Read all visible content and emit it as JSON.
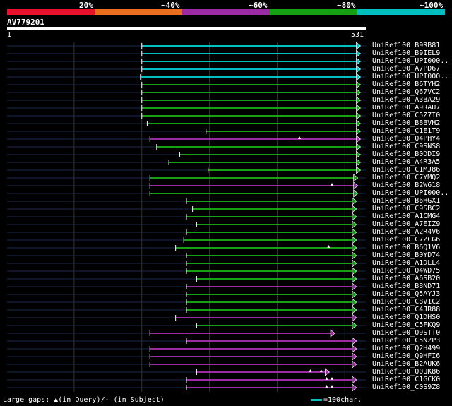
{
  "color_scale": {
    "labels": [
      "20%",
      "~40%",
      "~60%",
      "~80%",
      "~100%"
    ],
    "colors": [
      "#e8102d",
      "#e86f1c",
      "#9b2ba3",
      "#16a016",
      "#00bfc0"
    ]
  },
  "query": {
    "name": "AV779201",
    "start": "1",
    "end": "531",
    "length": 531
  },
  "colors": {
    "background": "#000000",
    "grid": "#333333",
    "track": "#1b2a4d",
    "text": "#ffffff"
  },
  "hits": [
    {
      "name": "UniRef100_B9RB81",
      "start": 200,
      "end": 519,
      "color": "#00bfc0",
      "arrow": "end",
      "gaps": []
    },
    {
      "name": "UniRef100_B9IEL9",
      "start": 200,
      "end": 519,
      "color": "#00bfc0",
      "arrow": "end",
      "gaps": []
    },
    {
      "name": "UniRef100_UPI000..",
      "start": 200,
      "end": 519,
      "color": "#00bfc0",
      "arrow": "end",
      "gaps": []
    },
    {
      "name": "UniRef100_A7PD67",
      "start": 200,
      "end": 519,
      "color": "#00bfc0",
      "arrow": "end",
      "gaps": []
    },
    {
      "name": "UniRef100_UPI000..",
      "start": 198,
      "end": 519,
      "color": "#00bfc0",
      "arrow": "end",
      "gaps": []
    },
    {
      "name": "UniRef100_B6TYH2",
      "start": 200,
      "end": 519,
      "color": "#16a016",
      "arrow": "end",
      "gaps": []
    },
    {
      "name": "UniRef100_Q67VC2",
      "start": 200,
      "end": 519,
      "color": "#16a016",
      "arrow": "end",
      "gaps": []
    },
    {
      "name": "UniRef100_A3BA29",
      "start": 200,
      "end": 519,
      "color": "#16a016",
      "arrow": "end",
      "gaps": []
    },
    {
      "name": "UniRef100_A9RAU7",
      "start": 200,
      "end": 519,
      "color": "#16a016",
      "arrow": "end",
      "gaps": []
    },
    {
      "name": "UniRef100_C5Z7I0",
      "start": 200,
      "end": 519,
      "color": "#16a016",
      "arrow": "end",
      "gaps": []
    },
    {
      "name": "UniRef100_B8BVH2",
      "start": 208,
      "end": 519,
      "color": "#16a016",
      "arrow": "end",
      "gaps": []
    },
    {
      "name": "UniRef100_C1E1T9",
      "start": 295,
      "end": 519,
      "color": "#16a016",
      "arrow": "end",
      "gaps": []
    },
    {
      "name": "UniRef100_Q4PHY4",
      "start": 212,
      "end": 519,
      "color": "#9b2ba3",
      "arrow": "end",
      "gaps": [
        433
      ]
    },
    {
      "name": "UniRef100_C9SNS8",
      "start": 222,
      "end": 519,
      "color": "#16a016",
      "arrow": "end",
      "gaps": []
    },
    {
      "name": "UniRef100_B0DDI9",
      "start": 256,
      "end": 519,
      "color": "#16a016",
      "arrow": "end",
      "gaps": []
    },
    {
      "name": "UniRef100_A4R3A5",
      "start": 240,
      "end": 519,
      "color": "#16a016",
      "arrow": "end",
      "gaps": []
    },
    {
      "name": "UniRef100_C1MJ86",
      "start": 298,
      "end": 519,
      "color": "#16a016",
      "arrow": "end",
      "gaps": []
    },
    {
      "name": "UniRef100_C7YMQ2",
      "start": 212,
      "end": 515,
      "color": "#16a016",
      "arrow": "end",
      "gaps": []
    },
    {
      "name": "UniRef100_B2W618",
      "start": 212,
      "end": 515,
      "color": "#9b2ba3",
      "arrow": "end",
      "gaps": [
        481
      ]
    },
    {
      "name": "UniRef100_UPI000..",
      "start": 212,
      "end": 515,
      "color": "#16a016",
      "arrow": "end",
      "gaps": []
    },
    {
      "name": "UniRef100_B6HGX1",
      "start": 266,
      "end": 513,
      "color": "#16a016",
      "arrow": "end",
      "gaps": []
    },
    {
      "name": "UniRef100_C9SBC2",
      "start": 275,
      "end": 513,
      "color": "#16a016",
      "arrow": "end",
      "gaps": []
    },
    {
      "name": "UniRef100_A1CMG4",
      "start": 266,
      "end": 513,
      "color": "#16a016",
      "arrow": "end",
      "gaps": []
    },
    {
      "name": "UniRef100_A7EIZ9",
      "start": 281,
      "end": 513,
      "color": "#16a016",
      "arrow": "end",
      "gaps": []
    },
    {
      "name": "UniRef100_A2R4V6",
      "start": 266,
      "end": 513,
      "color": "#16a016",
      "arrow": "end",
      "gaps": []
    },
    {
      "name": "UniRef100_C7ZCG6",
      "start": 262,
      "end": 513,
      "color": "#16a016",
      "arrow": "end",
      "gaps": []
    },
    {
      "name": "UniRef100_B6Q1V6",
      "start": 250,
      "end": 513,
      "color": "#16a016",
      "arrow": "end",
      "gaps": [
        476
      ]
    },
    {
      "name": "UniRef100_B0YD74",
      "start": 266,
      "end": 513,
      "color": "#16a016",
      "arrow": "end",
      "gaps": []
    },
    {
      "name": "UniRef100_A1DLL4",
      "start": 266,
      "end": 513,
      "color": "#16a016",
      "arrow": "end",
      "gaps": []
    },
    {
      "name": "UniRef100_Q4WD75",
      "start": 266,
      "end": 513,
      "color": "#16a016",
      "arrow": "end",
      "gaps": []
    },
    {
      "name": "UniRef100_A6SB20",
      "start": 281,
      "end": 513,
      "color": "#16a016",
      "arrow": "end",
      "gaps": []
    },
    {
      "name": "UniRef100_B8ND71",
      "start": 266,
      "end": 513,
      "color": "#9b2ba3",
      "arrow": "end",
      "gaps": []
    },
    {
      "name": "UniRef100_Q5AYJ3",
      "start": 266,
      "end": 513,
      "color": "#16a016",
      "arrow": "end",
      "gaps": []
    },
    {
      "name": "UniRef100_C8V1C2",
      "start": 266,
      "end": 513,
      "color": "#16a016",
      "arrow": "end",
      "gaps": []
    },
    {
      "name": "UniRef100_C4JR88",
      "start": 266,
      "end": 513,
      "color": "#16a016",
      "arrow": "end",
      "gaps": []
    },
    {
      "name": "UniRef100_Q1DHS0",
      "start": 250,
      "end": 513,
      "color": "#9b2ba3",
      "arrow": "end",
      "gaps": []
    },
    {
      "name": "UniRef100_C5FKQ9",
      "start": 281,
      "end": 513,
      "color": "#16a016",
      "arrow": "end",
      "gaps": []
    },
    {
      "name": "UniRef100_Q9STT0",
      "start": 212,
      "end": 481,
      "color": "#9b2ba3",
      "arrow": "end",
      "gaps": []
    },
    {
      "name": "UniRef100_C5NZP3",
      "start": 266,
      "end": 513,
      "color": "#9b2ba3",
      "arrow": "end",
      "gaps": []
    },
    {
      "name": "UniRef100_Q2H499",
      "start": 212,
      "end": 513,
      "color": "#9b2ba3",
      "arrow": "end",
      "gaps": []
    },
    {
      "name": "UniRef100_Q9HFI6",
      "start": 212,
      "end": 513,
      "color": "#9b2ba3",
      "arrow": "end",
      "gaps": []
    },
    {
      "name": "UniRef100_B2AUK6",
      "start": 212,
      "end": 513,
      "color": "#9b2ba3",
      "arrow": "end",
      "gaps": []
    },
    {
      "name": "UniRef100_Q0UK86",
      "start": 281,
      "end": 473,
      "color": "#9b2ba3",
      "arrow": "end",
      "gaps": [
        449,
        465
      ]
    },
    {
      "name": "UniRef100_C1GCK0",
      "start": 266,
      "end": 513,
      "color": "#9b2ba3",
      "arrow": "end",
      "gaps": [
        473,
        481
      ]
    },
    {
      "name": "UniRef100_C0S9Z8",
      "start": 266,
      "end": 513,
      "color": "#9b2ba3",
      "arrow": "end",
      "gaps": [
        473,
        481
      ]
    }
  ],
  "legend": {
    "gaps_text": "Large gaps: ▲(in Query)/- (in Subject)",
    "scale_text": "=100char."
  }
}
